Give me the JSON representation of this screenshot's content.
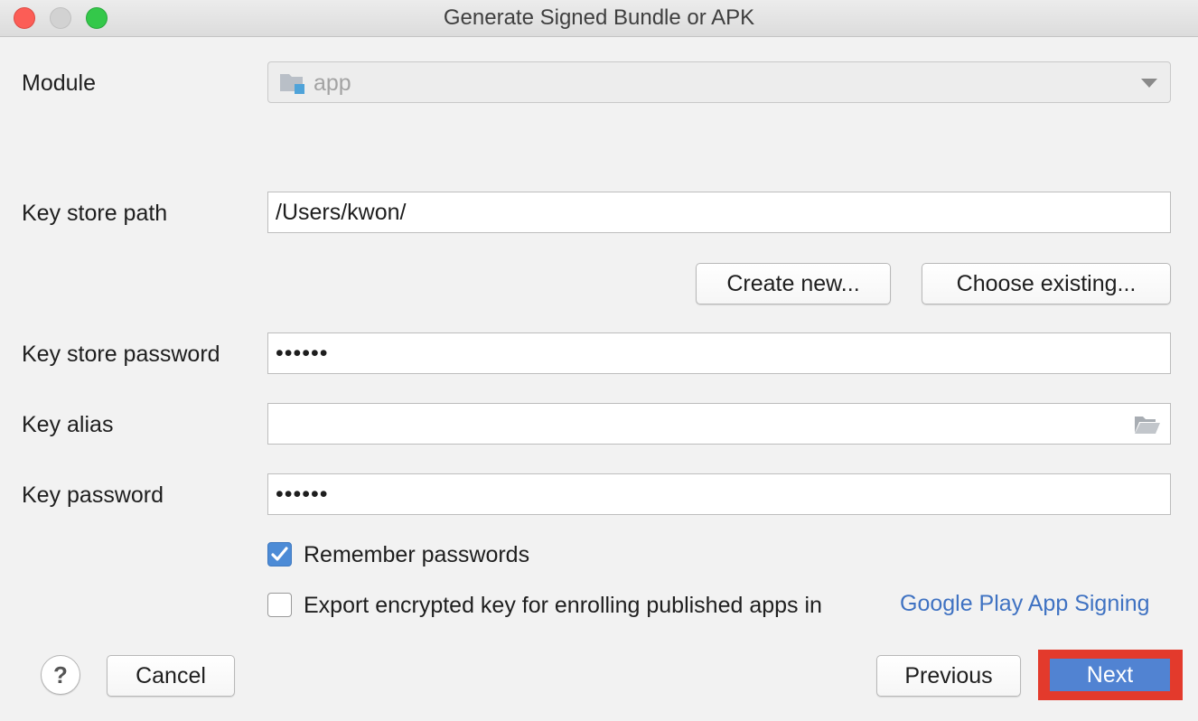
{
  "window": {
    "title": "Generate Signed Bundle or APK"
  },
  "module": {
    "label": "Module",
    "value": "app"
  },
  "keystore": {
    "path_label": "Key store path",
    "path_value": "/Users/kwon/",
    "create_new_label": "Create new...",
    "choose_existing_label": "Choose existing...",
    "password_label": "Key store password",
    "password_value": "••••••"
  },
  "key": {
    "alias_label": "Key alias",
    "alias_value": "",
    "password_label": "Key password",
    "password_value": "••••••"
  },
  "options": {
    "remember_passwords_label": "Remember passwords",
    "remember_passwords_checked": true,
    "export_label": "Export encrypted key for enrolling published apps in",
    "export_checked": false,
    "export_link": "Google Play App Signing"
  },
  "footer": {
    "help_label": "?",
    "cancel_label": "Cancel",
    "previous_label": "Previous",
    "next_label": "Next"
  },
  "colors": {
    "accent": "#5183d2",
    "link": "#3f72c2",
    "highlight": "#e33a2c",
    "checkbox_checked": "#4c8bd6"
  }
}
